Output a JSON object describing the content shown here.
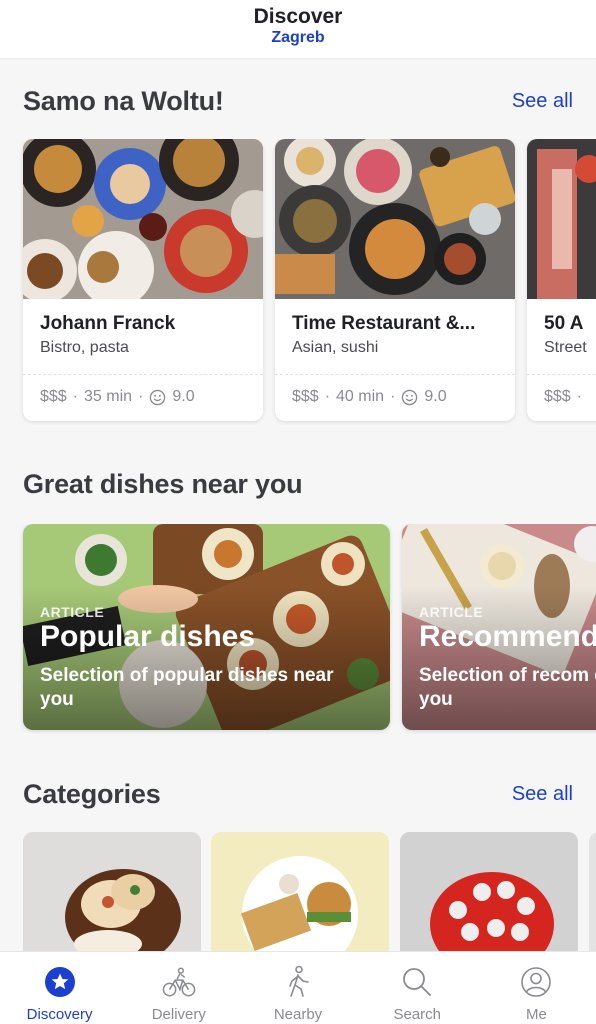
{
  "header": {
    "title": "Discover",
    "city": "Zagreb"
  },
  "section_woltu": {
    "title": "Samo na Woltu!",
    "see_all": "See all",
    "venues": [
      {
        "name": "Johann Franck",
        "tags": "Bistro, pasta",
        "price": "$$$",
        "time": "35 min",
        "rating": "9.0"
      },
      {
        "name": "Time Restaurant &...",
        "tags": "Asian, sushi",
        "price": "$$$",
        "time": "40 min",
        "rating": "9.0"
      },
      {
        "name": "50 A",
        "tags": "Street",
        "price": "$$$",
        "time": "",
        "rating": ""
      }
    ]
  },
  "section_dishes": {
    "title": "Great dishes near you",
    "articles": [
      {
        "kicker": "ARTICLE",
        "title": "Popular dishes",
        "description": "Selection of popular dishes near you"
      },
      {
        "kicker": "ARTICLE",
        "title": "Recommend",
        "description": "Selection of recom dishes near you"
      }
    ]
  },
  "section_categories": {
    "title": "Categories",
    "see_all": "See all"
  },
  "tabbar": {
    "tabs": [
      {
        "label": "Discovery",
        "icon": "star-badge-icon",
        "active": true
      },
      {
        "label": "Delivery",
        "icon": "bicycle-courier-icon",
        "active": false
      },
      {
        "label": "Nearby",
        "icon": "walking-person-icon",
        "active": false
      },
      {
        "label": "Search",
        "icon": "magnifier-icon",
        "active": false
      },
      {
        "label": "Me",
        "icon": "user-circle-icon",
        "active": false
      }
    ]
  },
  "colors": {
    "accent": "#1c3fd1",
    "text": "#202125",
    "muted": "#8a8b90",
    "background": "#f6f6f6"
  },
  "separator": "·"
}
